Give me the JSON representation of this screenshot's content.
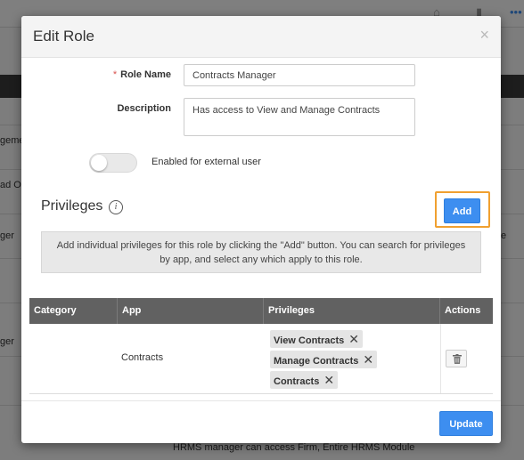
{
  "background": {
    "row_texts": [
      "geme",
      "ad On",
      "ger",
      "ger"
    ],
    "right_text": "e",
    "bottom_text": "HRMS manager can access Firm, Entire HRMS Module"
  },
  "modal": {
    "title": "Edit Role",
    "close_glyph": "×",
    "role_name": {
      "required_mark": "*",
      "label": "Role Name",
      "value": "Contracts Manager"
    },
    "description": {
      "label": "Description",
      "value": "Has access to View and Manage Contracts"
    },
    "external_user": {
      "label": "Enabled for external user",
      "enabled": false
    },
    "privileges": {
      "title": "Privileges",
      "info_glyph": "i",
      "add_label": "Add",
      "help_text": "Add individual privileges for this role by clicking the \"Add\" button. You can search for privileges by app, and select any which apply to this role.",
      "columns": [
        "Category",
        "App",
        "Privileges",
        "Actions"
      ],
      "rows": [
        {
          "category": "",
          "app": "Contracts",
          "privileges": [
            "View Contracts",
            "Manage Contracts",
            "Contracts"
          ]
        }
      ]
    },
    "update_label": "Update"
  },
  "colors": {
    "primary": "#3d8ef0",
    "focus_ring": "#f0a030",
    "table_header": "#616161",
    "required": "#d9534f"
  },
  "icons": [
    "close-icon",
    "info-icon",
    "remove-icon",
    "trash-icon"
  ]
}
